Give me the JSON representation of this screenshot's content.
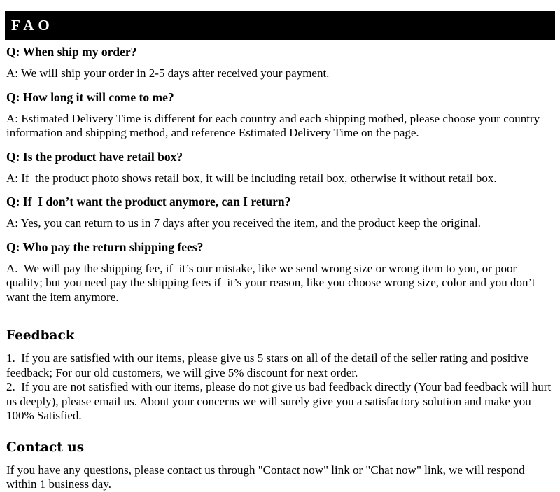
{
  "header": {
    "title": "FAO"
  },
  "faq": {
    "items": [
      {
        "question": "Q: When ship my order?",
        "answer": "A: We will ship your order in 2-5 days after received your payment."
      },
      {
        "question": "Q: How long it will come to me?",
        "answer": "A: Estimated Delivery Time is different for each country and each shipping mothed, please choose your country information and shipping method, and reference Estimated Delivery Time on the page."
      },
      {
        "question": "Q: Is the product have retail box?",
        "answer": "A: If  the product photo shows retail box, it will be including retail box, otherwise it without retail box."
      },
      {
        "question": "Q: If  I don’t want the product anymore, can I return?",
        "answer": "A: Yes, you can return to us in 7 days after you received the item, and the product keep the original."
      },
      {
        "question": "Q: Who pay the return shipping fees?",
        "answer": "A.  We will pay the shipping fee, if  it’s our mistake, like we send wrong size or wrong item to you, or poor quality; but you need pay the shipping fees if  it’s your reason, like you choose wrong size, color and you don’t want the item anymore."
      }
    ]
  },
  "feedback": {
    "heading": "Feedback",
    "item1": "1.  If you are satisfied with our items, please give us 5 stars on all of the detail of the seller rating and positive feedback; For our old customers, we will give 5% discount for next order.",
    "item2": "2.  If you are not satisfied with our items, please do not give us bad feedback directly (Your bad feedback will hurt us deeply), please email us. About your concerns we will surely give you a satisfactory solution and make you 100% Satisfied."
  },
  "contact": {
    "heading": "Contact us",
    "body": "If you have any questions, please contact us through \"Contact now\" link or \"Chat now\" link, we will respond within 1 business day."
  },
  "colors": {
    "header_background": "#000000",
    "header_text": "#ffffff",
    "page_background": "#ffffff",
    "body_text": "#000000"
  }
}
